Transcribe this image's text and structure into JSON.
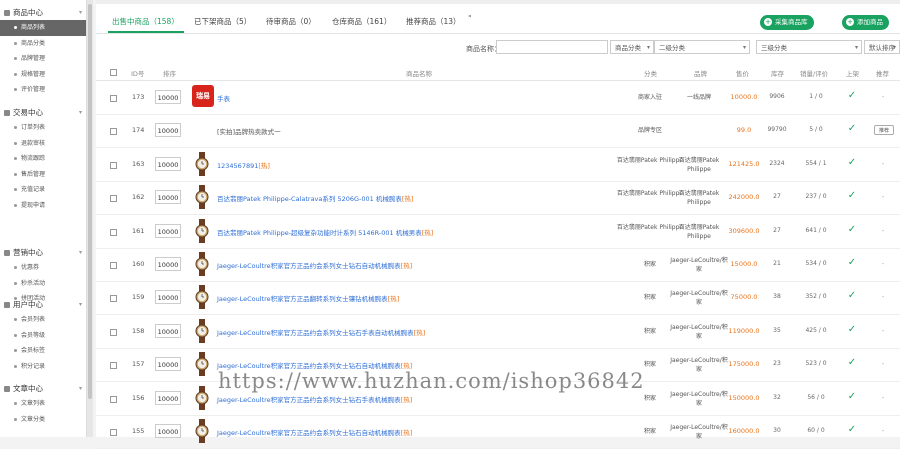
{
  "sidebar": {
    "groups": [
      {
        "label": "商品中心",
        "items": [
          "商品列表",
          "商品分类",
          "品牌管理",
          "规格管理",
          "评价管理"
        ]
      },
      {
        "label": "交易中心",
        "items": [
          "订单列表",
          "退款审核",
          "物流跟踪",
          "售后管理",
          "充值记录",
          "提现申请"
        ]
      },
      {
        "label": "营销中心",
        "items": [
          "优惠券",
          "秒杀活动",
          "拼团活动"
        ]
      },
      {
        "label": "用户中心",
        "items": [
          "会员列表",
          "会员等级",
          "会员标签",
          "积分记录"
        ]
      },
      {
        "label": "文章中心",
        "items": [
          "文章列表",
          "文章分类"
        ]
      }
    ]
  },
  "tabs": [
    "出售中商品（158）",
    "已下架商品（5）",
    "待审商品（0）",
    "仓库商品（161）",
    "推荐商品（13）"
  ],
  "tab_quote": "\"",
  "buttons": {
    "collect": "采集商品库",
    "add": "添加商品"
  },
  "filters": {
    "name_label": "商品名称：",
    "name_value": "",
    "cat1": "商品分类",
    "cat2": "二级分类",
    "cat3": "三级分类",
    "sort": "默认排序"
  },
  "table": {
    "headers": {
      "id": "ID号",
      "sort": "排序",
      "name": "商品名称",
      "category": "分类",
      "brand": "品牌",
      "price": "售价",
      "stock": "库存",
      "sales": "销量/评价",
      "shelf": "上架",
      "recommend": "推荐"
    },
    "rows": [
      {
        "id": "173",
        "sort": "10000",
        "thumb": "logo",
        "logo_text": "瑞易",
        "name": "手表",
        "tag": "",
        "category": "商家入驻",
        "brand": "一线品牌",
        "price": "10000.0",
        "stock": "9906",
        "sales": "1 / 0",
        "shelf": "✓",
        "rec": "-"
      },
      {
        "id": "174",
        "sort": "10000",
        "thumb": "none",
        "name": "[实拍]品牌热卖款式一",
        "tag": "",
        "category": "品牌专区",
        "brand": "",
        "price": "99.0",
        "stock": "99790",
        "sales": "5 / 0",
        "shelf": "✓",
        "rec": "推荐"
      },
      {
        "id": "163",
        "sort": "10000",
        "thumb": "watch",
        "name": "1234567891",
        "tag": "[热]",
        "category": "百达翡丽Patek Philippe",
        "brand": "百达翡丽Patek Philippe",
        "price": "121425.0",
        "stock": "2324",
        "sales": "554 / 1",
        "shelf": "✓",
        "rec": "-"
      },
      {
        "id": "162",
        "sort": "10000",
        "thumb": "watch",
        "name": "百达翡丽Patek Philippe-Calatrava系列 5206G-001 机械腕表",
        "tag": "[热]",
        "category": "百达翡丽Patek Philippe",
        "brand": "百达翡丽Patek Philippe",
        "price": "242000.0",
        "stock": "27",
        "sales": "237 / 0",
        "shelf": "✓",
        "rec": "-"
      },
      {
        "id": "161",
        "sort": "10000",
        "thumb": "watch",
        "name": "百达翡丽Patek Philippe-超级复杂功能时计系列 5146R-001 机械男表",
        "tag": "[热]",
        "category": "百达翡丽Patek Philippe",
        "brand": "百达翡丽Patek Philippe",
        "price": "309600.0",
        "stock": "27",
        "sales": "641 / 0",
        "shelf": "✓",
        "rec": "-"
      },
      {
        "id": "160",
        "sort": "10000",
        "thumb": "watch",
        "name": "Jaeger-LeCoultre积家官方正品约会系列女士钻石自动机械腕表",
        "tag": "[热]",
        "category": "积家",
        "brand": "Jaeger-LeCoultre/积家",
        "price": "15000.0",
        "stock": "21",
        "sales": "534 / 0",
        "shelf": "✓",
        "rec": "-"
      },
      {
        "id": "159",
        "sort": "10000",
        "thumb": "watch",
        "name": "Jaeger-LeCoultre积家官方正品翻转系列女士镶钻机械腕表",
        "tag": "[热]",
        "category": "积家",
        "brand": "Jaeger-LeCoultre/积家",
        "price": "75000.0",
        "stock": "38",
        "sales": "352 / 0",
        "shelf": "✓",
        "rec": "-"
      },
      {
        "id": "158",
        "sort": "10000",
        "thumb": "watch",
        "name": "Jaeger-LeCoultre积家官方正品约会系列女士钻石手表自动机械腕表",
        "tag": "[热]",
        "category": "积家",
        "brand": "Jaeger-LeCoultre/积家",
        "price": "119000.0",
        "stock": "35",
        "sales": "425 / 0",
        "shelf": "✓",
        "rec": "-"
      },
      {
        "id": "157",
        "sort": "10000",
        "thumb": "watch",
        "name": "Jaeger-LeCoultre积家官方正品约会系列女士钻石自动机械腕表",
        "tag": "[热]",
        "category": "积家",
        "brand": "Jaeger-LeCoultre/积家",
        "price": "175000.0",
        "stock": "23",
        "sales": "523 / 0",
        "shelf": "✓",
        "rec": "-"
      },
      {
        "id": "156",
        "sort": "10000",
        "thumb": "watch",
        "name": "Jaeger-LeCoultre积家官方正品约会系列女士钻石手表机械腕表",
        "tag": "[热]",
        "category": "积家",
        "brand": "Jaeger-LeCoultre/积家",
        "price": "150000.0",
        "stock": "32",
        "sales": "56 / 0",
        "shelf": "✓",
        "rec": "-"
      },
      {
        "id": "155",
        "sort": "10000",
        "thumb": "watch",
        "name": "Jaeger-LeCoultre积家官方正品约会系列女士钻石自动机械腕表",
        "tag": "[热]",
        "category": "积家",
        "brand": "Jaeger-LeCoultre/积家",
        "price": "160000.0",
        "stock": "30",
        "sales": "60 / 0",
        "shelf": "✓",
        "rec": "-"
      }
    ]
  },
  "watermark": "https://www.huzhan.com/ishop36842",
  "colors": {
    "accent": "#1aa260",
    "price": "#e8731a",
    "link": "#2f6fd6"
  }
}
